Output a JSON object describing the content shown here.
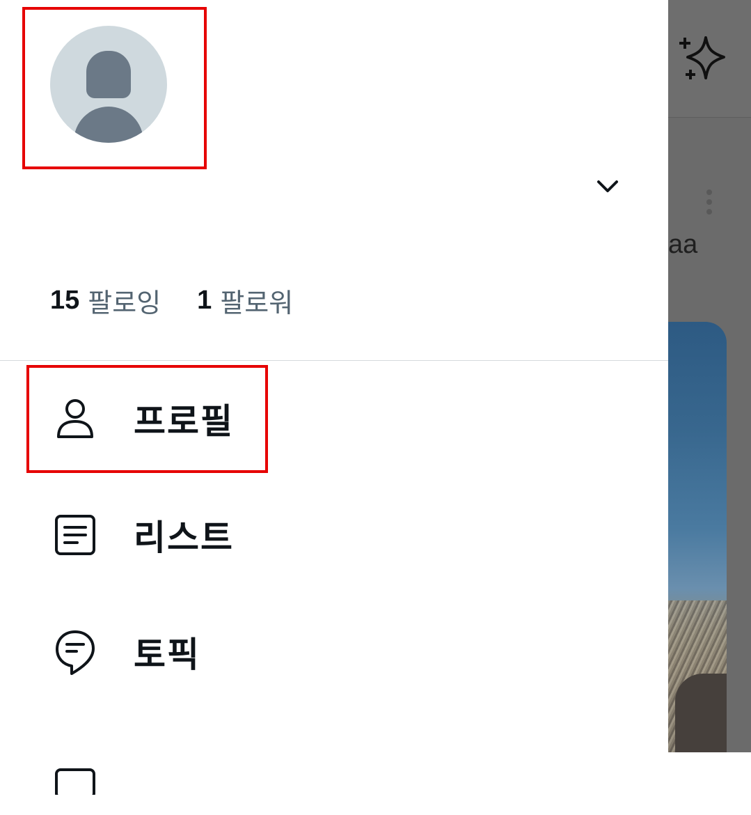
{
  "drawer": {
    "counts": {
      "following_count": "15",
      "following_label": "팔로잉",
      "followers_count": "1",
      "followers_label": "팔로워"
    },
    "menu": [
      {
        "label": "프로필",
        "icon": "person-icon"
      },
      {
        "label": "리스트",
        "icon": "list-icon"
      },
      {
        "label": "토픽",
        "icon": "topic-icon"
      }
    ]
  },
  "background_feed": {
    "partial_text": "aa",
    "icons": [
      "sparkle-icon",
      "more-vertical-icon"
    ]
  },
  "colors": {
    "primary_text": "#0f1419",
    "secondary_text": "#536471",
    "highlight": "#e60000",
    "avatar_bg": "#cfd9de"
  }
}
